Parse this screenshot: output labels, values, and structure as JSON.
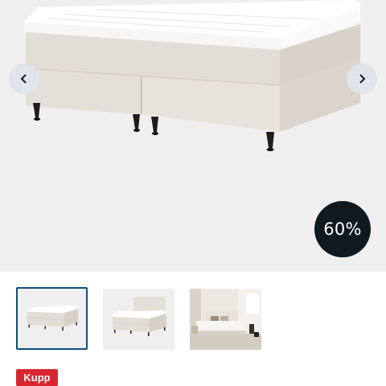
{
  "gallery": {
    "main_image": "boxspring-bed-beige",
    "prev_icon": "chevron-left-icon",
    "next_icon": "chevron-right-icon",
    "discount_label": "60%",
    "thumbnails": [
      {
        "image": "bed-front-view",
        "selected": true
      },
      {
        "image": "bed-with-headboard",
        "selected": false
      },
      {
        "image": "bed-in-bedroom",
        "selected": false
      }
    ]
  },
  "badge": {
    "label": "Kupp",
    "color": "#d7262f"
  },
  "colors": {
    "accent": "#0f4f7a",
    "discount_bg": "#101820"
  }
}
